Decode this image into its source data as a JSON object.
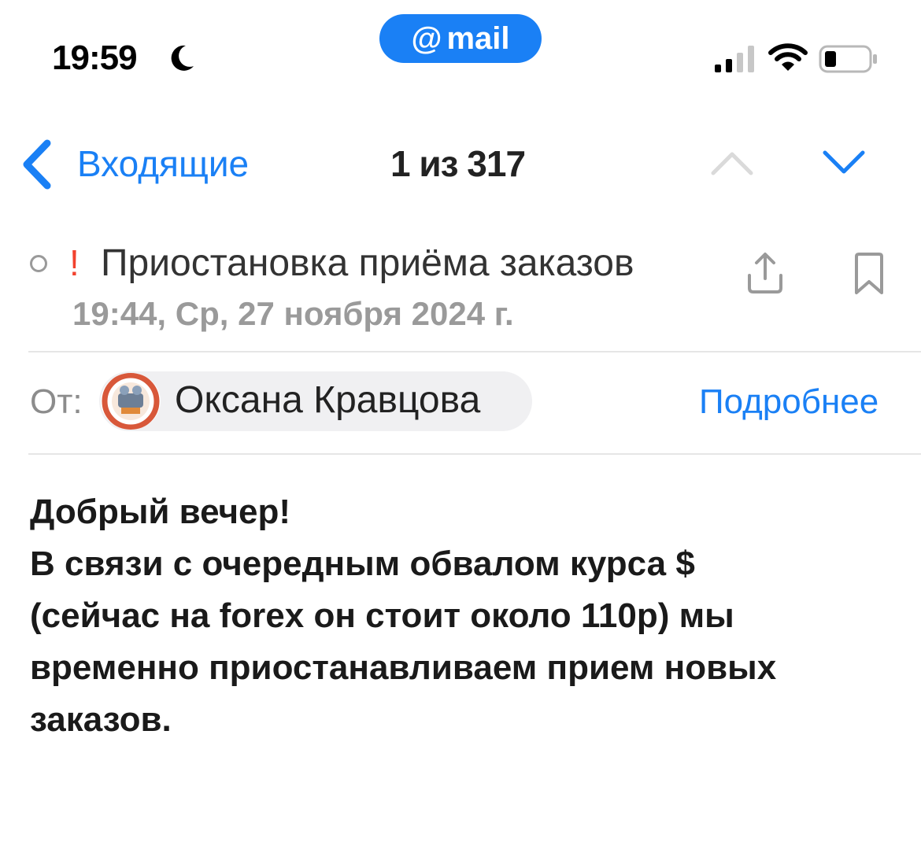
{
  "status_bar": {
    "time": "19:59",
    "focus_icon": "moon-icon",
    "mail_badge": {
      "at": "@",
      "label": "mail",
      "color": "#1a80f5"
    },
    "signal_icon": "cellular-signal-icon",
    "wifi_icon": "wifi-icon",
    "battery_icon": "battery-icon"
  },
  "nav": {
    "back_label": "Входящие",
    "counter": "1 из 317",
    "prev_icon": "chevron-up-icon",
    "next_icon": "chevron-down-icon"
  },
  "message": {
    "important_mark": "!",
    "subject": "Приостановка приёма заказов",
    "date": "19:44, Ср, 27 ноября 2024 г.",
    "share_icon": "share-icon",
    "bookmark_icon": "bookmark-icon",
    "from_label": "От:",
    "sender_name": "Оксана Кравцова",
    "details_link": "Подробнее",
    "body_lines": [
      "Добрый вечер!",
      "В связи с очередным обвалом курса $",
      "(сейчас на forex он стоит около  110р) мы",
      "временно приостанавливаем прием новых",
      "заказов."
    ]
  },
  "colors": {
    "accent": "#1a80f5",
    "important": "#f2422e",
    "muted": "#9a9a9a"
  }
}
